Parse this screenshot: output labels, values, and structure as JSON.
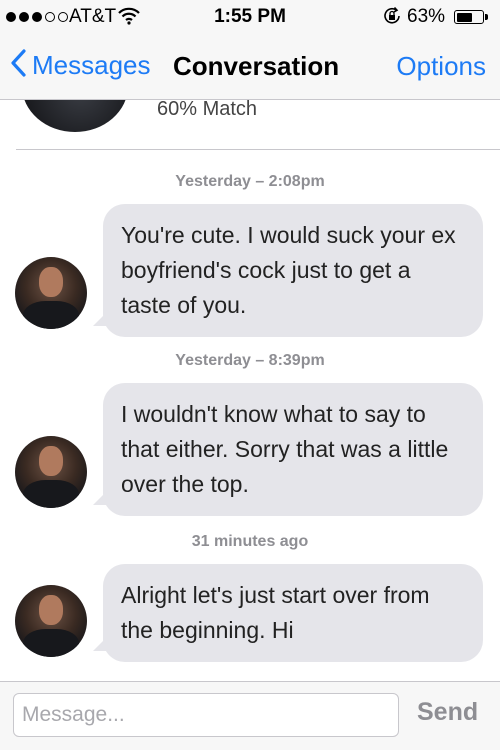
{
  "status_bar": {
    "carrier": "AT&T",
    "time": "1:55 PM",
    "battery_percent": "63%",
    "battery_level": 0.63,
    "signal_bars": 3
  },
  "nav": {
    "back_label": "Messages",
    "title": "Conversation",
    "options_label": "Options"
  },
  "profile": {
    "match": "60% Match"
  },
  "messages": [
    {
      "timestamp": "Yesterday – 2:08pm",
      "text": "You're cute. I would suck your ex boyfriend's cock just to get a taste of you."
    },
    {
      "timestamp": "Yesterday – 8:39pm",
      "text": "I wouldn't know what to say to that either. Sorry that was a little over the top."
    },
    {
      "timestamp": "31 minutes ago",
      "text": "Alright let's just start over from the beginning. Hi"
    }
  ],
  "input": {
    "placeholder": "Message...",
    "value": "",
    "send_label": "Send"
  },
  "colors": {
    "accent": "#1d7bf5",
    "bubble": "#e5e5ea",
    "timestamp": "#8e8e93"
  },
  "icons": [
    "wifi-icon",
    "rotation-lock-icon",
    "battery-icon",
    "back-chevron-icon",
    "signal-dots-icon"
  ]
}
